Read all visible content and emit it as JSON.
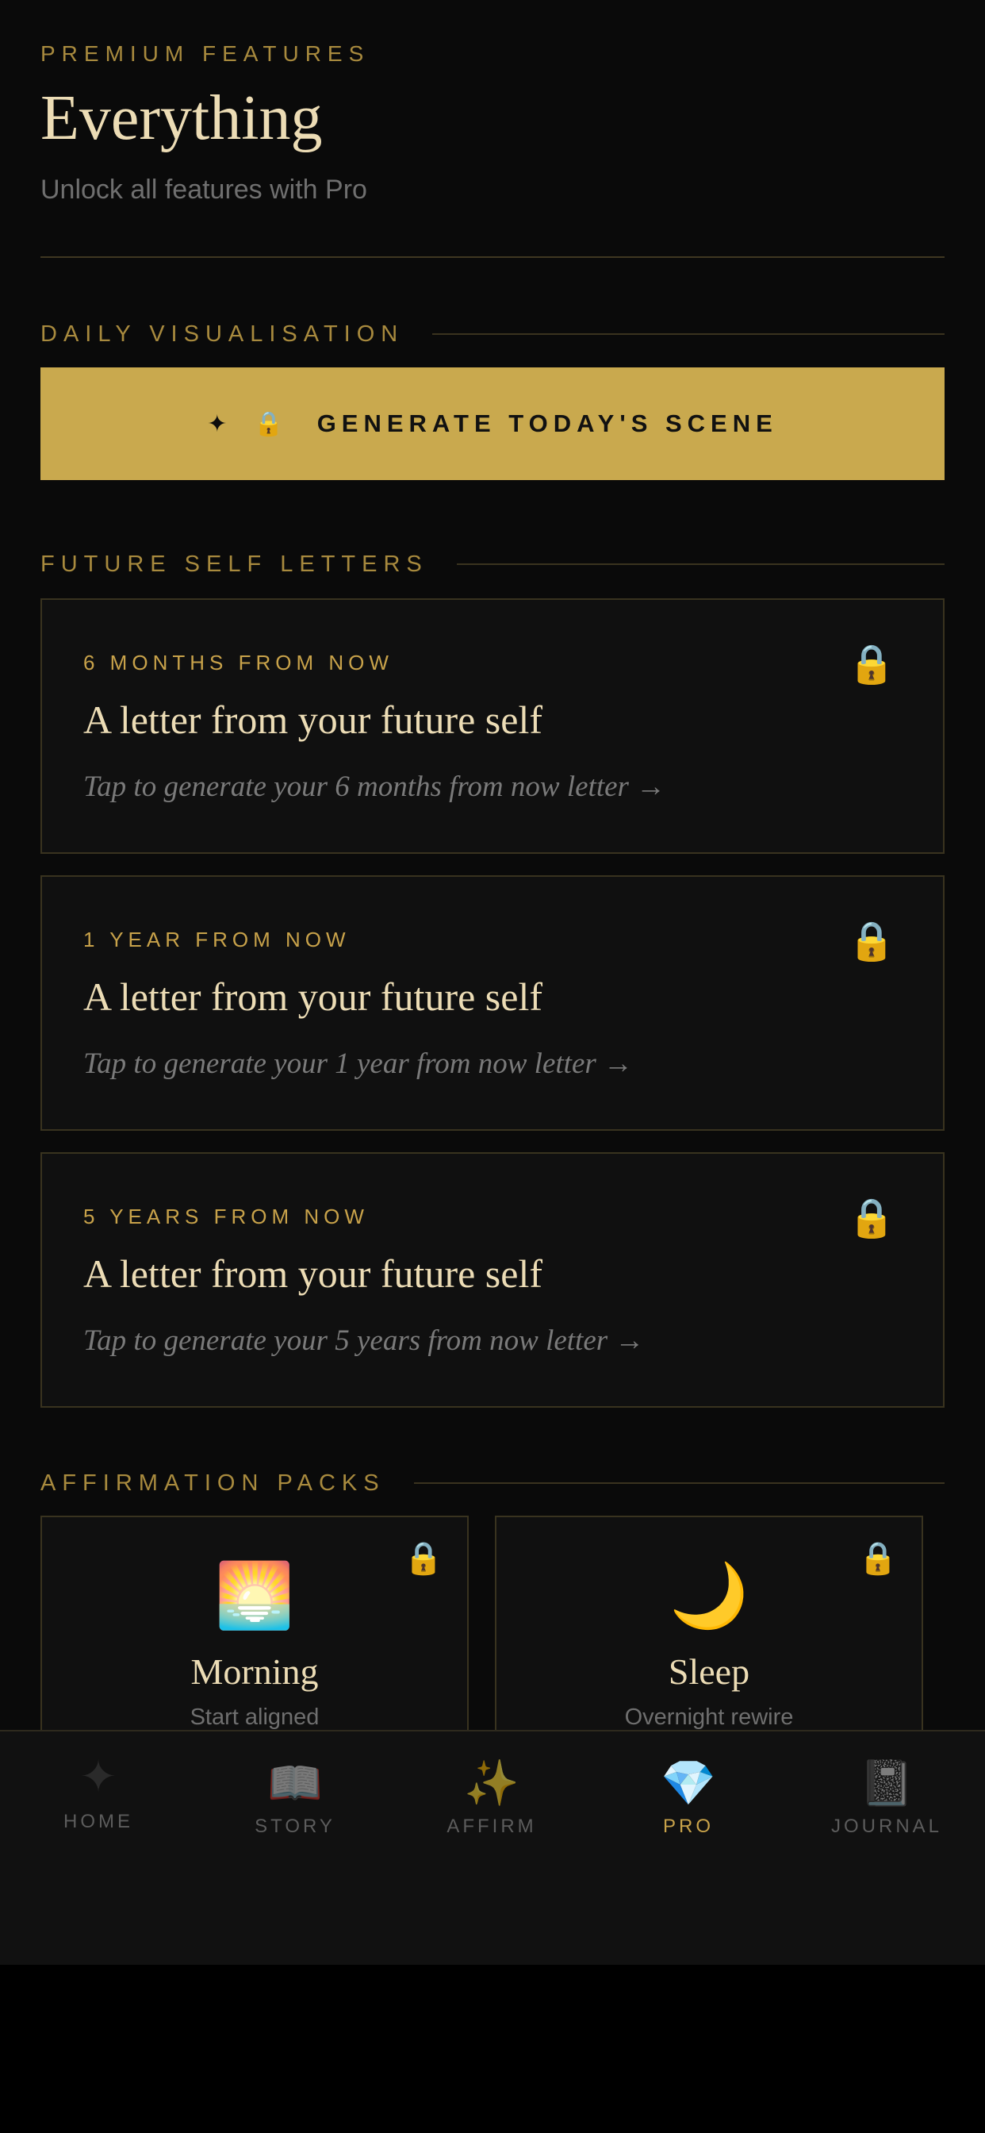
{
  "header": {
    "eyebrow": "PREMIUM FEATURES",
    "title": "Everything",
    "subtitle": "Unlock all features with Pro"
  },
  "daily": {
    "section_label": "DAILY VISUALISATION",
    "button_spark": "✦",
    "button_lock": "🔒",
    "button_label": "GENERATE TODAY'S SCENE"
  },
  "letters": {
    "section_label": "FUTURE SELF LETTERS",
    "lock_icon": "🔒",
    "items": [
      {
        "kicker": "6 MONTHS FROM NOW",
        "title": "A letter from your future self",
        "cta": "Tap to generate your 6 months from now letter →"
      },
      {
        "kicker": "1 YEAR FROM NOW",
        "title": "A letter from your future self",
        "cta": "Tap to generate your 1 year from now letter →"
      },
      {
        "kicker": "5 YEARS FROM NOW",
        "title": "A letter from your future self",
        "cta": "Tap to generate your 5 years from now letter →"
      }
    ]
  },
  "packs": {
    "section_label": "AFFIRMATION PACKS",
    "lock_icon": "🔒",
    "items": [
      {
        "emoji": "🌅",
        "name": "Morning",
        "desc": "Start aligned"
      },
      {
        "emoji": "🌙",
        "name": "Sleep",
        "desc": "Overnight rewire"
      }
    ]
  },
  "tabbar": {
    "items": [
      {
        "icon": "✦",
        "label": "HOME",
        "active": false
      },
      {
        "icon": "📖",
        "label": "STORY",
        "active": false
      },
      {
        "icon": "✨",
        "label": "AFFIRM",
        "active": false
      },
      {
        "icon": "💎",
        "label": "PRO",
        "active": true
      },
      {
        "icon": "📓",
        "label": "JOURNAL",
        "active": false
      }
    ]
  },
  "colors": {
    "accent": "#c9a94e",
    "background": "#0a0a0a",
    "text_primary": "#ecdcb5",
    "text_muted": "#6f6f6f"
  }
}
